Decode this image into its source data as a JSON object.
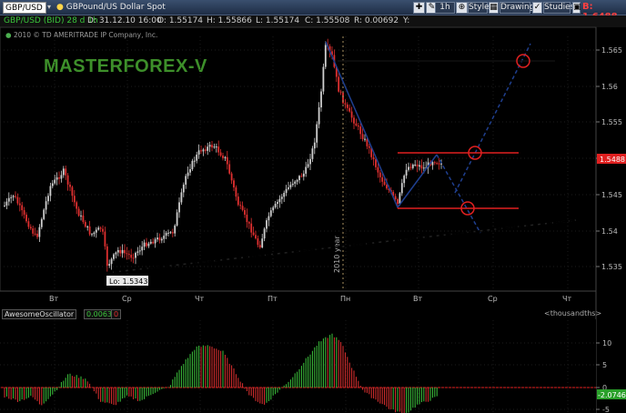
{
  "toolbar": {
    "symbol": "GBP/USD",
    "description": "GBPound/US Dollar Spot",
    "interval": "1h",
    "style": "Style",
    "drawings": "Drawings",
    "studies": "Studies",
    "bid": "B: 1.6488"
  },
  "info": {
    "symbol_period": "GBP/USD (BID) 28 d 1h",
    "date": "D: 31.12.10 16:00",
    "open": "O: 1.55174",
    "high": "H: 1.55866",
    "low": "L: 1.55174",
    "close": "C: 1.55508",
    "range": "R: 0.00692",
    "y": "Y:"
  },
  "copyright": "2010 © TD AMERITRADE IP Company, Inc.",
  "watermark": "MASTERFOREX-V",
  "price_axis": [
    "1.565",
    "1.56",
    "1.555",
    "1.55",
    "1.545",
    "1.54",
    "1.535"
  ],
  "current_price": "1.5488",
  "low_label": "Lo: 1.53435",
  "year_label": "2010 year",
  "time_axis": [
    "Вт",
    "Ср",
    "Чт",
    "Пт",
    "Пн",
    "Вт",
    "Ср",
    "Чт"
  ],
  "oscillator": {
    "name": "AwesomeOscillator",
    "value": "0.0063",
    "zero": "0",
    "unit": "<thousandths>",
    "axis": [
      "10",
      "5",
      "0",
      "-5"
    ],
    "current": "-2.0746"
  },
  "colors": {
    "up": "#cfcfcf",
    "down": "#e03030",
    "osc_up": "#3dc43d",
    "osc_down": "#e03030",
    "trendline": "#1f3f8f",
    "resistance": "#e02020",
    "watermark": "#3d8f2a"
  },
  "icons": [
    "crosshair-icon",
    "pencil-icon",
    "zoom-icon",
    "grid-icon",
    "toggle-icon",
    "maximize-icon"
  ]
}
